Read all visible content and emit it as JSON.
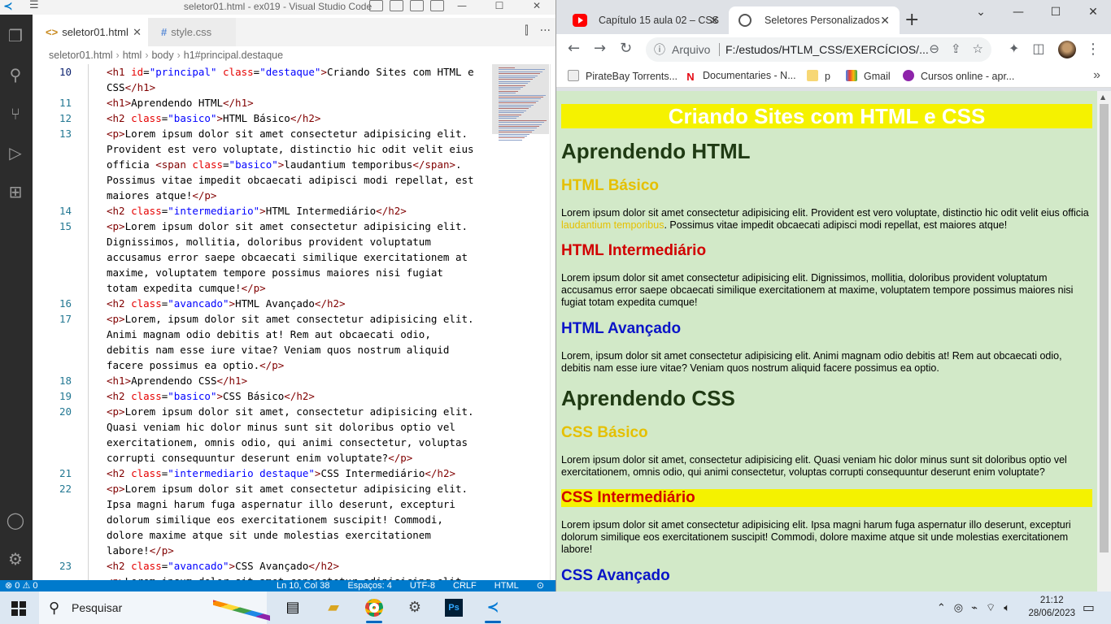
{
  "vscode": {
    "title": "seletor01.html - ex019 - Visual Studio Code",
    "tabs": [
      {
        "label": "seletor01.html",
        "icon": "<>"
      },
      {
        "label": "style.css",
        "icon": "#"
      }
    ],
    "breadcrumb": [
      "seletor01.html",
      "html",
      "body",
      "h1#principal.destaque"
    ],
    "line_numbers": [
      "10",
      "11",
      "12",
      "13",
      "14",
      "15",
      "16",
      "17",
      "18",
      "19",
      "20",
      "21",
      "22",
      "23"
    ],
    "status": {
      "errors": "0",
      "warnings": "0",
      "position": "Ln 10, Col 38",
      "spaces": "Espaços: 4",
      "encoding": "UTF-8",
      "eol": "CRLF",
      "language": "HTML"
    }
  },
  "chrome": {
    "tabs": [
      {
        "label": "Capítulo 15 aula 02 – CSS"
      },
      {
        "label": "Seletores Personalizados"
      }
    ],
    "address": {
      "prefix": "Arquivo",
      "url": "F:/estudos/HTLM_CSS/EXERCÍCIOS/..."
    },
    "bookmarks": [
      {
        "label": "PirateBay Torrents..."
      },
      {
        "label": "Documentaries - N..."
      },
      {
        "label": "p"
      },
      {
        "label": "Gmail"
      },
      {
        "label": "Cursos online - apr..."
      }
    ],
    "page": {
      "title": "Criando Sites com HTML e CSS",
      "section_html": "Aprendendo HTML",
      "html_basico": "HTML Básico",
      "html_basico_p1": "Lorem ipsum dolor sit amet consectetur adipisicing elit. Provident est vero voluptate, distinctio hic odit velit eius officia ",
      "html_basico_span": "laudantium temporibus",
      "html_basico_p2": ". Possimus vitae impedit obcaecati adipisci modi repellat, est maiores atque!",
      "html_inter": "HTML Intermediário",
      "html_inter_p": "Lorem ipsum dolor sit amet consectetur adipisicing elit. Dignissimos, mollitia, doloribus provident voluptatum accusamus error saepe obcaecati similique exercitationem at maxime, voluptatem tempore possimus maiores nisi fugiat totam expedita cumque!",
      "html_avanc": "HTML Avançado",
      "html_avanc_p": "Lorem, ipsum dolor sit amet consectetur adipisicing elit. Animi magnam odio debitis at! Rem aut obcaecati odio, debitis nam esse iure vitae? Veniam quos nostrum aliquid facere possimus ea optio.",
      "section_css": "Aprendendo CSS",
      "css_basico": "CSS Básico",
      "css_basico_p": "Lorem ipsum dolor sit amet, consectetur adipisicing elit. Quasi veniam hic dolor minus sunt sit doloribus optio vel exercitationem, omnis odio, qui animi consectetur, voluptas corrupti consequuntur deserunt enim voluptate?",
      "css_inter": "CSS Intermediário",
      "css_inter_p": "Lorem ipsum dolor sit amet consectetur adipisicing elit. Ipsa magni harum fuga aspernatur illo deserunt, excepturi dolorum similique eos exercitationem suscipit! Commodi, dolore maxime atque sit unde molestias exercitationem labore!",
      "css_avanc": "CSS Avançado"
    }
  },
  "taskbar": {
    "search_label": "Pesquisar",
    "time": "21:12",
    "date": "28/06/2023"
  },
  "colors": {
    "vscode_accent": "#007acc",
    "page_background": "#d2e9c8",
    "destaque": "#f5f200",
    "basico": "#e5c000",
    "intermediario": "#d10000",
    "avancado": "#0a14c8"
  }
}
